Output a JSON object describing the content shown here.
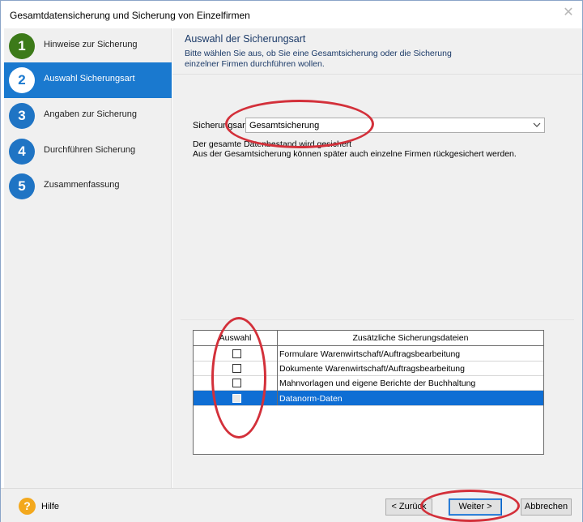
{
  "window": {
    "title": "Gesamtdatensicherung und Sicherung von Einzelfirmen",
    "close_glyph": "✕"
  },
  "sidebar": {
    "steps": [
      {
        "number": "1",
        "label": "Hinweise zur Sicherung",
        "state": "done"
      },
      {
        "number": "2",
        "label": "Auswahl Sicherungsart",
        "state": "active"
      },
      {
        "number": "3",
        "label": "Angaben zur Sicherung",
        "state": "pending"
      },
      {
        "number": "4",
        "label": "Durchführen Sicherung",
        "state": "pending"
      },
      {
        "number": "5",
        "label": "Zusammenfassung",
        "state": "pending"
      }
    ]
  },
  "main": {
    "title": "Auswahl der Sicherungsart",
    "description": "Bitte wählen Sie aus, ob Sie eine Gesamtsicherung oder die Sicherung einzelner Firmen durchführen wollen.",
    "field_label": "Sicherungsart",
    "select_value": "Gesamtsicherung",
    "info_line1": "Der gesamte Datenbestand wird gesichert",
    "info_line2": "Aus der Gesamtsicherung können später auch einzelne Firmen rückgesichert werden."
  },
  "table": {
    "columns": [
      "Auswahl",
      "Zusätzliche Sicherungsdateien"
    ],
    "rows": [
      {
        "label": "Formulare Warenwirtschaft/Auftragsbearbeitung",
        "checked": false,
        "selected": false
      },
      {
        "label": "Dokumente Warenwirtschaft/Auftragsbearbeitung",
        "checked": false,
        "selected": false
      },
      {
        "label": "Mahnvorlagen und eigene Berichte der Buchhaltung",
        "checked": false,
        "selected": false
      },
      {
        "label": "Datanorm-Daten",
        "checked": false,
        "selected": true
      }
    ]
  },
  "footer": {
    "help_icon": "?",
    "help_label": "Hilfe",
    "back_label": "< Zurück",
    "next_label": "Weiter >",
    "cancel_label": "Abbrechen"
  },
  "colors": {
    "accent": "#1a79cf",
    "step_done": "#3c7a19",
    "selection": "#0f6ed4",
    "annotation": "#d3303a",
    "help": "#f3a81d"
  },
  "icons": {
    "help": "question-icon",
    "close": "close-icon",
    "dropdown": "chevron-down-icon"
  }
}
